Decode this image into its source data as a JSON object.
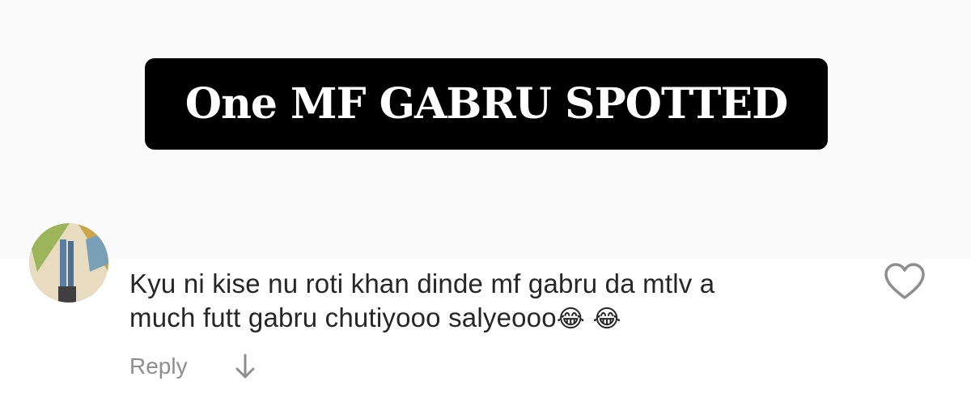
{
  "post": {
    "caption": "One MF GABRU SPOTTED"
  },
  "comment": {
    "line1": "Kyu ni kise nu roti khan dinde mf gabru da mtlv a",
    "line2": "much futt gabru chutiyooo salyeooo",
    "emoji1": "😂",
    "emoji2": "😂",
    "reply_label": "Reply",
    "like_icon": "heart-outline-icon",
    "translate_icon": "arrow-down-icon"
  },
  "colors": {
    "caption_bg": "#000000",
    "caption_text": "#ffffff",
    "comment_text": "#262626",
    "secondary_text": "#8e8e8e"
  }
}
